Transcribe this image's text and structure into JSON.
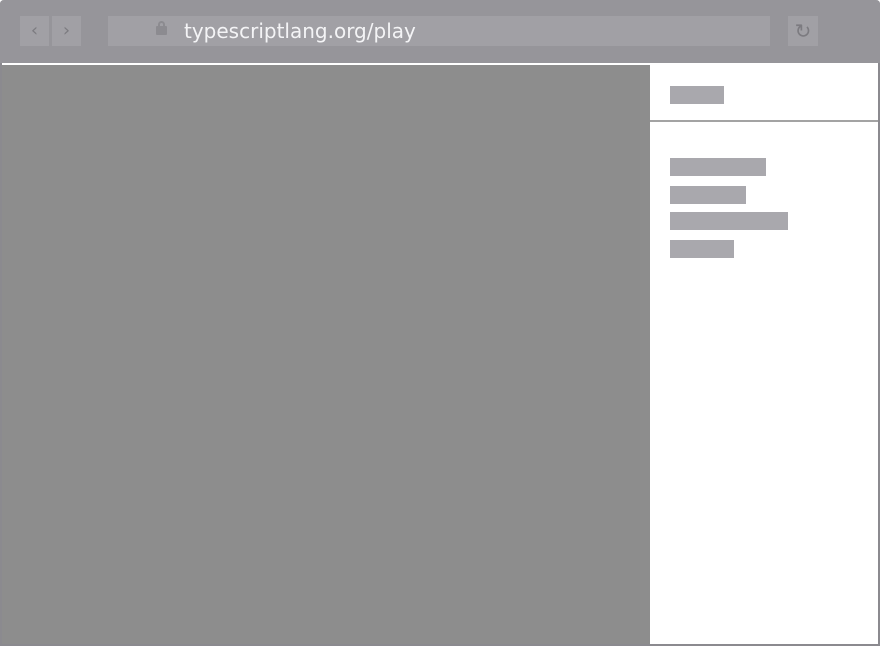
{
  "browser": {
    "url": "typescriptlang.org/play",
    "back_icon": "chevron-left",
    "forward_icon": "chevron-right",
    "lock_icon": "lock",
    "reload_icon": "reload"
  }
}
